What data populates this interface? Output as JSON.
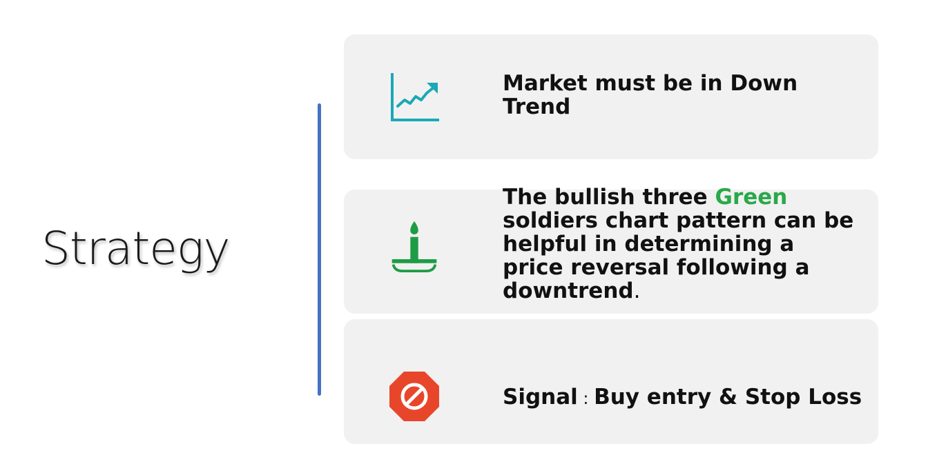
{
  "slide": {
    "title": "Strategy",
    "accent_line_color": "#4472c4"
  },
  "cards": [
    {
      "icon": "trending-chart-icon",
      "icon_color": "#1aa9b5",
      "text": "Market must be in  Down Trend"
    },
    {
      "icon": "candle-icon",
      "icon_color": "#1e9c45",
      "text_before": "The bullish three ",
      "highlight": "Green",
      "highlight_color": "#2aa84a",
      "text_after": " soldiers chart pattern can be helpful in determining a price reversal following a downtrend",
      "trailing": "."
    },
    {
      "icon": "stop-sign-icon",
      "icon_color": "#e8462a",
      "label": "Signal",
      "separator": " : ",
      "value": "Buy entry & Stop Loss"
    }
  ]
}
